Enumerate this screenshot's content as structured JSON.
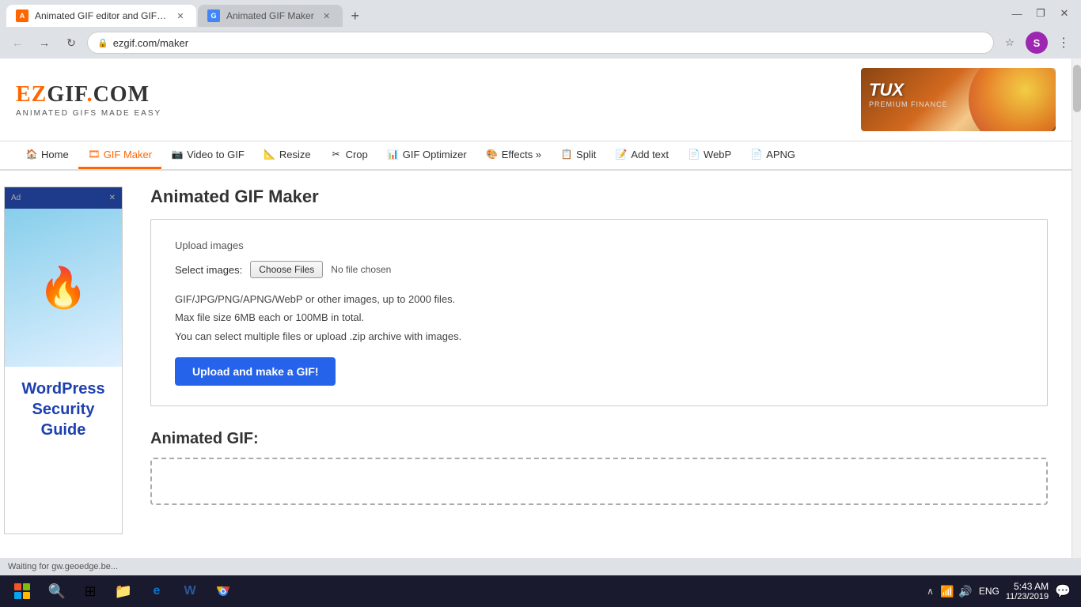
{
  "browser": {
    "tabs": [
      {
        "id": "tab1",
        "title": "Animated GIF editor and GIF ma...",
        "favicon": "A",
        "favicon_color": "#ff6600",
        "active": true
      },
      {
        "id": "tab2",
        "title": "Animated GIF Maker",
        "favicon": "G",
        "favicon_color": "#4285f4",
        "active": false
      }
    ],
    "url": "ezgif.com/maker",
    "url_protocol": "https://",
    "profile_letter": "S",
    "window_controls": {
      "minimize": "—",
      "maximize": "❐",
      "close": "✕"
    }
  },
  "nav": {
    "items": [
      {
        "label": "Home",
        "icon": "🏠",
        "active": false
      },
      {
        "label": "GIF Maker",
        "icon": "🎞",
        "active": true
      },
      {
        "label": "Video to GIF",
        "icon": "📷",
        "active": false
      },
      {
        "label": "Resize",
        "icon": "📐",
        "active": false
      },
      {
        "label": "Crop",
        "icon": "✂",
        "active": false
      },
      {
        "label": "GIF Optimizer",
        "icon": "📊",
        "active": false
      },
      {
        "label": "Effects »",
        "icon": "🎨",
        "active": false
      },
      {
        "label": "Split",
        "icon": "📋",
        "active": false
      },
      {
        "label": "Add text",
        "icon": "📝",
        "active": false
      },
      {
        "label": "WebP",
        "icon": "📄",
        "active": false
      },
      {
        "label": "APNG",
        "icon": "📄",
        "active": false
      }
    ]
  },
  "logo": {
    "main": "EZGIF.COM",
    "sub": "ANIMATED GIFS MADE EASY"
  },
  "sidebar_ad": {
    "title": "WordPress Security Guide",
    "close_btn": "✕"
  },
  "main": {
    "page_title": "Animated GIF Maker",
    "upload_section": {
      "title": "Upload images",
      "select_label": "Select images:",
      "choose_btn": "Choose Files",
      "no_file_text": "No file chosen",
      "info_lines": [
        "GIF/JPG/PNG/APNG/WebP or other images, up to 2000 files.",
        "Max file size 6MB each or 100MB in total.",
        "You can select multiple files or upload .zip archive with images."
      ],
      "upload_btn": "Upload and make a GIF!"
    },
    "animated_gif_section": {
      "title": "Animated GIF:"
    }
  },
  "status_bar": {
    "text": "Waiting for gw.geoedge.be..."
  },
  "taskbar": {
    "time": "5:43 AM",
    "date": "11/23/2019",
    "lang": "ENG",
    "apps": [
      {
        "name": "file-explorer",
        "icon": "📁"
      },
      {
        "name": "task-view",
        "icon": "⊞"
      },
      {
        "name": "edge",
        "icon": "e"
      },
      {
        "name": "word",
        "icon": "W"
      },
      {
        "name": "chrome",
        "icon": "◎"
      }
    ]
  }
}
